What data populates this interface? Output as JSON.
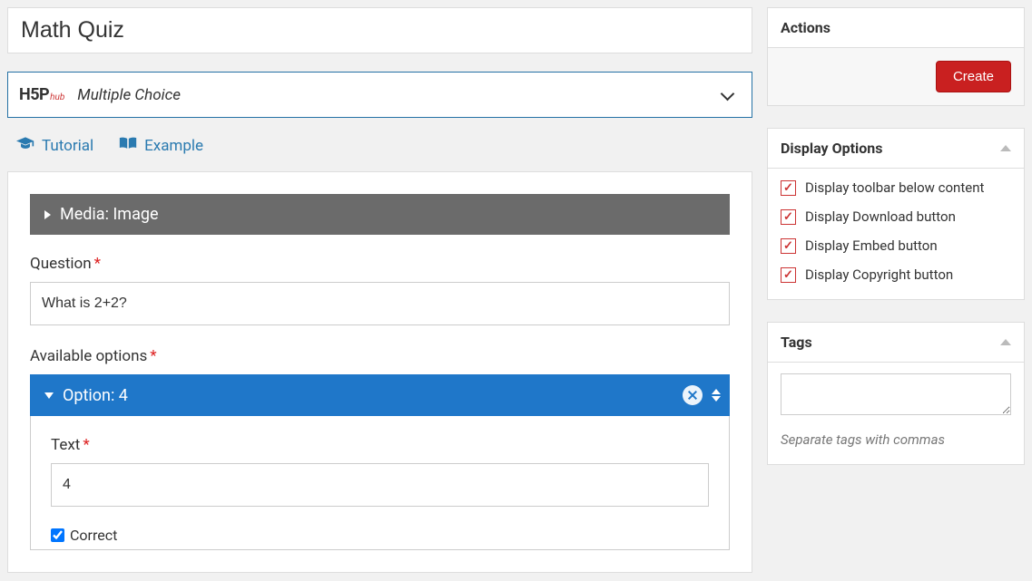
{
  "title_value": "Math Quiz",
  "type_selector": {
    "logo_main": "H",
    "logo_five": "5",
    "logo_p": "P",
    "logo_hub": "hub",
    "selected": "Multiple Choice"
  },
  "help_links": {
    "tutorial": "Tutorial",
    "example": "Example"
  },
  "media_section": {
    "header": "Media: Image"
  },
  "question": {
    "label": "Question",
    "value": "What is 2+2?"
  },
  "options": {
    "label": "Available options",
    "option_header": "Option: 4",
    "text_label": "Text",
    "text_value": "4",
    "correct_label": "Correct",
    "correct_checked": true
  },
  "sidebar": {
    "actions": {
      "title": "Actions",
      "create": "Create"
    },
    "display_options": {
      "title": "Display Options",
      "items": [
        {
          "label": "Display toolbar below content",
          "checked": true
        },
        {
          "label": "Display Download button",
          "checked": true
        },
        {
          "label": "Display Embed button",
          "checked": true
        },
        {
          "label": "Display Copyright button",
          "checked": true
        }
      ]
    },
    "tags": {
      "title": "Tags",
      "value": "",
      "hint": "Separate tags with commas"
    }
  }
}
